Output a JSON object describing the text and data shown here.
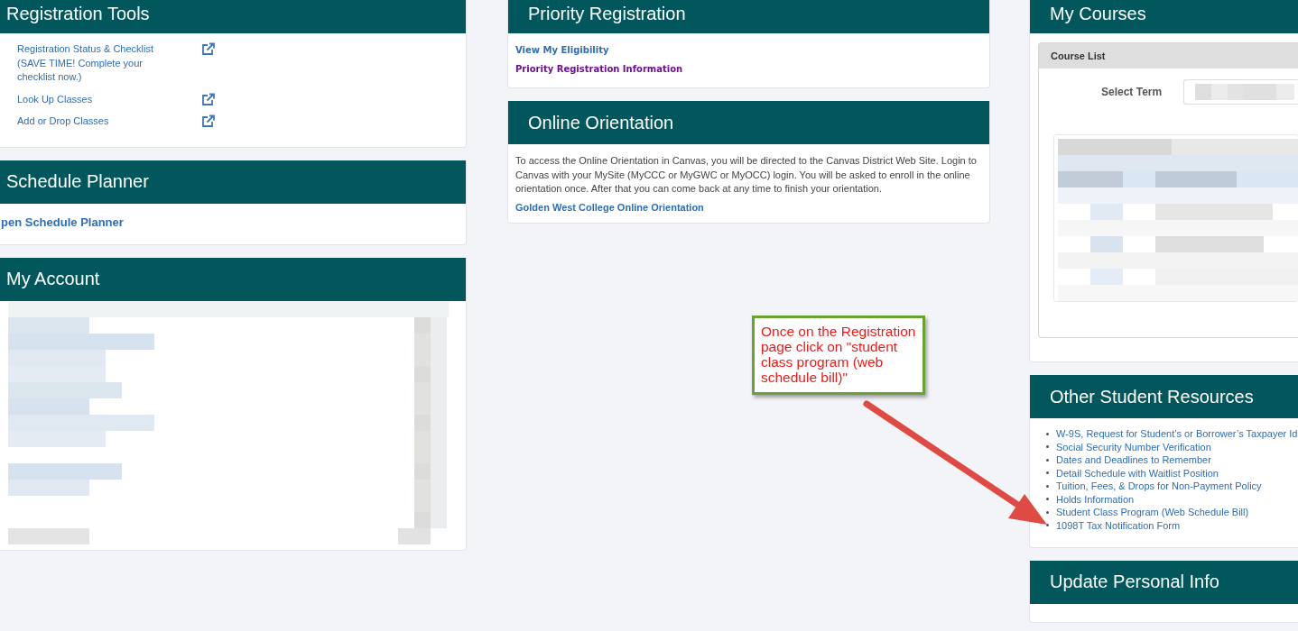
{
  "columns": [
    {
      "panels": [
        {
          "kind": "tools",
          "title": "Registration Tools",
          "items": [
            {
              "label": "Registration Status & Checklist (SAVE TIME! Complete your checklist now.)"
            },
            {
              "label": "Look Up Classes"
            },
            {
              "label": "Add or Drop Classes"
            }
          ]
        },
        {
          "kind": "planner",
          "title": "Schedule Planner",
          "link": "pen Schedule Planner"
        },
        {
          "kind": "account",
          "title": "My Account"
        }
      ]
    },
    {
      "panels": [
        {
          "kind": "priority",
          "title": "Priority Registration",
          "items": [
            {
              "label": "View My Eligibility",
              "visited": false
            },
            {
              "label": "Priority Registration Information",
              "visited": true
            }
          ]
        },
        {
          "kind": "orientation",
          "title": "Online Orientation",
          "text": "To access the Online Orientation in Canvas, you will be directed to the Canvas District Web Site. Login to Canvas with your MySite (MyCCC or MyGWC or MyOCC) login. You will be asked to enroll in the online orientation once. After that you can come back at any time to finish your orientation.",
          "link": "Golden West College Online Orientation"
        }
      ]
    },
    {
      "panels": [
        {
          "kind": "courses",
          "title": "My Courses",
          "box_title": "Course List",
          "field_label": "Select Term"
        },
        {
          "kind": "resources",
          "title": "Other Student Resources",
          "items": [
            {
              "label": "W-9S, Request for Student’s or Borrower’s Taxpayer Id"
            },
            {
              "label": "Social Security Number Verification"
            },
            {
              "label": "Dates and Deadlines to Remember"
            },
            {
              "label": "Detail Schedule with Waitlist Position"
            },
            {
              "label": "Tuition, Fees, & Drops for Non-Payment Policy"
            },
            {
              "label": "Holds Information"
            },
            {
              "label": "Student Class Program (Web Schedule Bill)"
            },
            {
              "label": "1098T Tax Notification Form"
            }
          ]
        },
        {
          "kind": "personal",
          "title": "Update Personal Info"
        }
      ]
    }
  ],
  "callout": {
    "text": "Once on the Registration page click on \"student class program (web schedule bill)\""
  }
}
